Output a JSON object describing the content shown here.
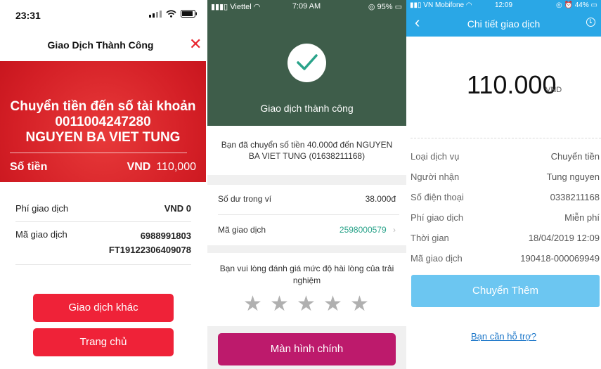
{
  "p1": {
    "time": "23:31",
    "title": "Giao Dịch Thành Công",
    "banner_line1": "Chuyển tiền đến số tài khoản",
    "banner_line2": "0011004247280",
    "banner_line3": "NGUYEN BA VIET TUNG",
    "amount_label": "Số tiền",
    "amount_currency": "VND",
    "amount_value": "110,000",
    "fee_label": "Phí giao dịch",
    "fee_value": "VND 0",
    "txn_label": "Mã giao dịch",
    "txn_value1": "6988991803",
    "txn_value2": "FT19122306409078",
    "btn_other": "Giao dịch khác",
    "btn_home": "Trang chủ"
  },
  "p2": {
    "carrier": "Viettel",
    "time": "7:09 AM",
    "battery": "95%",
    "success": "Giao dịch thành công",
    "message": "Bạn đã chuyển số tiền 40.000đ đến NGUYEN BA VIET TUNG (01638211168)",
    "balance_label": "Số dư trong ví",
    "balance_value": "38.000đ",
    "txn_label": "Mã giao dịch",
    "txn_value": "2598000579",
    "rate_text": "Bạn vui lòng đánh giá mức độ hài lòng của trải nghiệm",
    "btn_main": "Màn hình chính"
  },
  "p3": {
    "carrier": "VN Mobifone",
    "time": "12:09",
    "battery": "44%",
    "title": "Chi tiết giao dịch",
    "amount": "110.000",
    "currency": "VND",
    "rows": [
      {
        "label": "Loại dịch vụ",
        "value": "Chuyển tiền"
      },
      {
        "label": "Người nhận",
        "value": "Tung nguyen"
      },
      {
        "label": "Số điện thoại",
        "value": "0338211168"
      },
      {
        "label": "Phí giao dịch",
        "value": "Miễn phí"
      },
      {
        "label": "Thời gian",
        "value": "18/04/2019 12:09"
      },
      {
        "label": "Mã giao dịch",
        "value": "190418-000069949"
      }
    ],
    "btn_more": "Chuyển Thêm",
    "help": "Bạn cần hỗ trợ?"
  },
  "colors": {
    "red": "#ef2238",
    "dark_green": "#3e5d4a",
    "teal_link": "#2aa38a",
    "purple": "#bd1a6c",
    "blue_header": "#2aa7e6",
    "blue_button": "#6cc6f1"
  }
}
